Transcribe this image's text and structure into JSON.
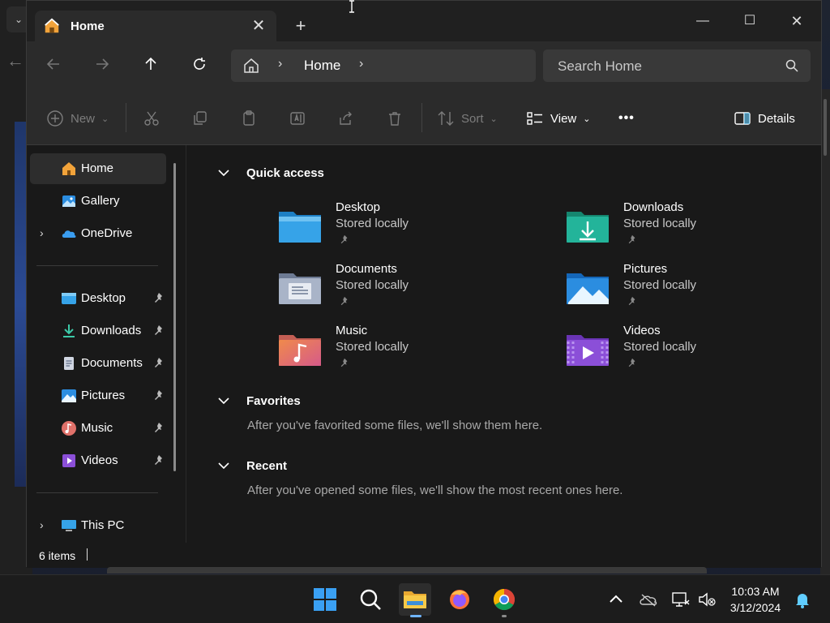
{
  "window": {
    "tab_title": "Home",
    "close_tab": "✕",
    "new_tab": "+",
    "minimize": "—",
    "maximize": "☐",
    "close": "✕"
  },
  "address": {
    "crumb": "Home",
    "search_placeholder": "Search Home"
  },
  "commands": {
    "new": "New",
    "sort": "Sort",
    "view": "View",
    "more": "•••",
    "details": "Details"
  },
  "sidebar": {
    "items": [
      {
        "label": "Home",
        "icon": "home-icon"
      },
      {
        "label": "Gallery",
        "icon": "gallery-icon"
      },
      {
        "label": "OneDrive",
        "icon": "onedrive-icon"
      },
      {
        "label": "Desktop",
        "icon": "desktop-folder-icon"
      },
      {
        "label": "Downloads",
        "icon": "downloads-icon"
      },
      {
        "label": "Documents",
        "icon": "documents-icon"
      },
      {
        "label": "Pictures",
        "icon": "pictures-icon"
      },
      {
        "label": "Music",
        "icon": "music-icon"
      },
      {
        "label": "Videos",
        "icon": "videos-icon"
      },
      {
        "label": "This PC",
        "icon": "this-pc-icon"
      }
    ]
  },
  "content": {
    "quick_access": "Quick access",
    "favorites": "Favorites",
    "favorites_empty": "After you've favorited some files, we'll show them here.",
    "recent": "Recent",
    "recent_empty": "After you've opened some files, we'll show the most recent ones here.",
    "tiles": [
      {
        "name": "Desktop",
        "sub": "Stored locally"
      },
      {
        "name": "Downloads",
        "sub": "Stored locally"
      },
      {
        "name": "Documents",
        "sub": "Stored locally"
      },
      {
        "name": "Pictures",
        "sub": "Stored locally"
      },
      {
        "name": "Music",
        "sub": "Stored locally"
      },
      {
        "name": "Videos",
        "sub": "Stored locally"
      }
    ]
  },
  "status": {
    "count": "6 items"
  },
  "taskbar": {
    "time": "10:03 AM",
    "date": "3/12/2024"
  },
  "colors": {
    "accent": "#60cdff",
    "folder_blue": "#36a3e8",
    "folder_teal": "#23b49a"
  }
}
